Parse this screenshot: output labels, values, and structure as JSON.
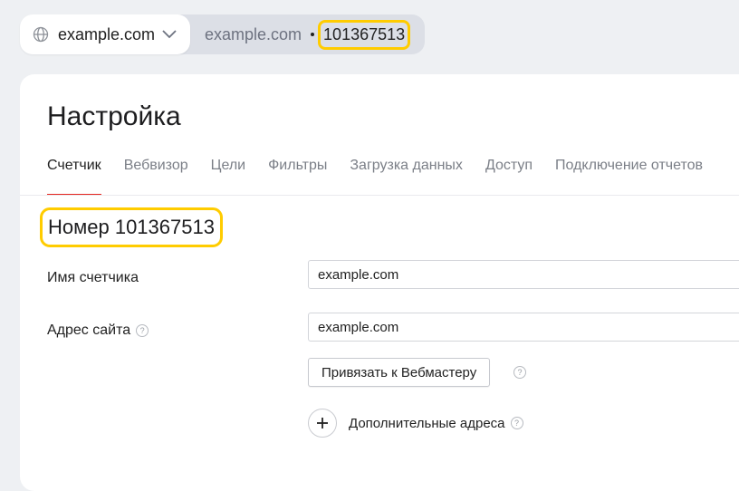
{
  "topbar": {
    "site_select_value": "example.com",
    "breadcrumb_site": "example.com",
    "breadcrumb_counter": "101367513"
  },
  "page": {
    "title": "Настройка",
    "tabs": [
      {
        "label": "Счетчик",
        "active": true
      },
      {
        "label": "Вебвизор",
        "active": false
      },
      {
        "label": "Цели",
        "active": false
      },
      {
        "label": "Фильтры",
        "active": false
      },
      {
        "label": "Загрузка данных",
        "active": false
      },
      {
        "label": "Доступ",
        "active": false
      },
      {
        "label": "Подключение отчетов",
        "active": false
      }
    ],
    "counter_number": "Номер 101367513"
  },
  "form": {
    "counter_name_label": "Имя счетчика",
    "counter_name_value": "example.com",
    "site_address_label": "Адрес сайта",
    "site_address_value": "example.com",
    "help_glyph": "?",
    "webmaster_button": "Привязать к Вебмастеру",
    "additional_addresses": "Дополнительные адреса"
  },
  "colors": {
    "highlight": "#ffcc00",
    "active_tab_underline": "#e52620",
    "background": "#eef0f3"
  },
  "icons": [
    "globe-icon",
    "chevron-down-icon",
    "help-icon",
    "plus-icon"
  ]
}
